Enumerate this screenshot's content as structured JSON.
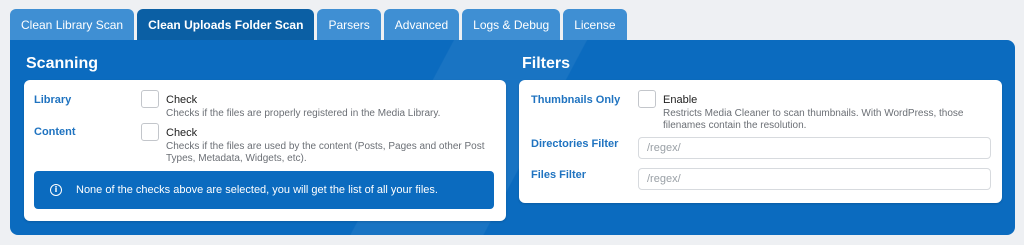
{
  "tabs": [
    {
      "label": "Clean Library Scan",
      "active": false
    },
    {
      "label": "Clean Uploads Folder Scan",
      "active": true
    },
    {
      "label": "Parsers",
      "active": false
    },
    {
      "label": "Advanced",
      "active": false
    },
    {
      "label": "Logs & Debug",
      "active": false
    },
    {
      "label": "License",
      "active": false
    }
  ],
  "scanning": {
    "title": "Scanning",
    "library": {
      "label": "Library",
      "check_label": "Check",
      "description": "Checks if the files are properly registered in the Media Library."
    },
    "content": {
      "label": "Content",
      "check_label": "Check",
      "description_line1": "Checks if the files are used by the content (Posts, Pages and other Post",
      "description_line2": "Types, Metadata, Widgets, etc)."
    },
    "notice": "None of the checks above are selected, you will get the list of all your files."
  },
  "filters": {
    "title": "Filters",
    "thumbnails_only": {
      "label": "Thumbnails Only",
      "check_label": "Enable",
      "description_line1": "Restricts Media Cleaner to scan thumbnails. With WordPress, those",
      "description_line2": "filenames contain the resolution."
    },
    "directories_filter": {
      "label": "Directories Filter",
      "placeholder": "/regex/"
    },
    "files_filter": {
      "label": "Files Filter",
      "placeholder": "/regex/"
    }
  },
  "colors": {
    "panel_blue": "#0b6bbf",
    "tab_blue": "#3f8fd3",
    "label_blue": "#1f73c0"
  }
}
